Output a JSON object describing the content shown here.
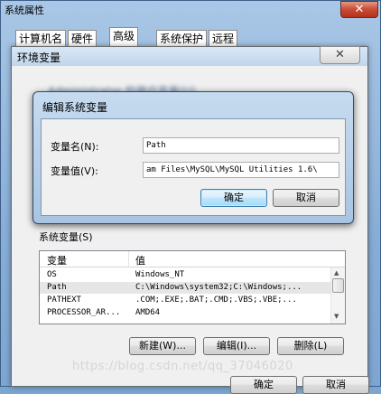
{
  "outer_window": {
    "title": "系统属性",
    "close_label": "✕"
  },
  "tabs": [
    "计算机名",
    "硬件",
    "高级",
    "系统保护",
    "远程"
  ],
  "env_dialog": {
    "title": "环境变量",
    "close_label": "✕",
    "user_vars_label_blurred": "Administrator 的用户变量(U)",
    "system_vars_label": "系统变量(S)",
    "table": {
      "columns": [
        "变量",
        "值"
      ],
      "rows": [
        {
          "name": "OS",
          "value": "Windows_NT"
        },
        {
          "name": "Path",
          "value": "C:\\Windows\\system32;C:\\Windows;..."
        },
        {
          "name": "PATHEXT",
          "value": ".COM;.EXE;.BAT;.CMD;.VBS;.VBE;..."
        },
        {
          "name": "PROCESSOR_AR...",
          "value": "AMD64"
        }
      ]
    },
    "buttons": {
      "new": "新建(W)...",
      "edit": "编辑(I)...",
      "delete": "删除(L)",
      "ok": "确定",
      "cancel": "取消"
    }
  },
  "edit_dialog": {
    "title": "编辑系统变量",
    "name_label": "变量名(N):",
    "value_label": "变量值(V):",
    "name_value": "Path",
    "value_value": "am Files\\MySQL\\MySQL Utilities 1.6\\",
    "ok": "确定",
    "cancel": "取消"
  },
  "watermark": "https://blog.csdn.net/qq_37046020"
}
